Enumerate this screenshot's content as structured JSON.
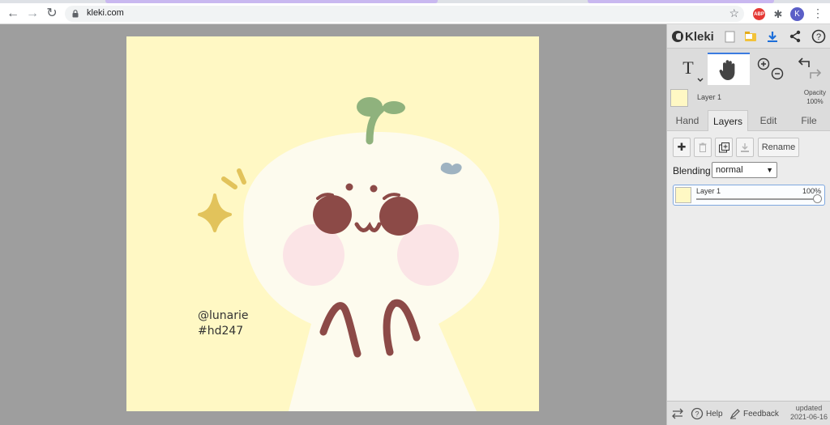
{
  "browser": {
    "url": "kleki.com",
    "avatar_letter": "K",
    "extension_label": "ABP",
    "accent_tab_color": "#c9b8f0"
  },
  "canvas": {
    "background": "#fff8c4",
    "signature_line1": "@lunarie",
    "signature_line2": "#hd247"
  },
  "app": {
    "brand": "Kleki",
    "top_icons": [
      "new-image-icon",
      "open-folder-icon",
      "download-icon",
      "share-icon",
      "help-icon"
    ],
    "tools": [
      "text-tool",
      "hand-tool",
      "zoom-in-icon",
      "zoom-out-icon",
      "undo-icon",
      "redo-icon"
    ],
    "active_tool": "hand-tool",
    "current_layer": {
      "name": "Layer 1",
      "opacity_label": "Opacity",
      "opacity_value": "100%"
    },
    "tabs": [
      {
        "label": "Hand"
      },
      {
        "label": "Layers"
      },
      {
        "label": "Edit"
      },
      {
        "label": "File"
      }
    ],
    "active_tab": "Layers",
    "layers_panel": {
      "rename_label": "Rename",
      "blending_label": "Blending",
      "blending_value": "normal",
      "layers": [
        {
          "name": "Layer 1",
          "opacity": "100%"
        }
      ]
    },
    "footer": {
      "help_label": "Help",
      "feedback_label": "Feedback",
      "updated_label": "updated",
      "updated_date": "2021-06-16"
    }
  }
}
